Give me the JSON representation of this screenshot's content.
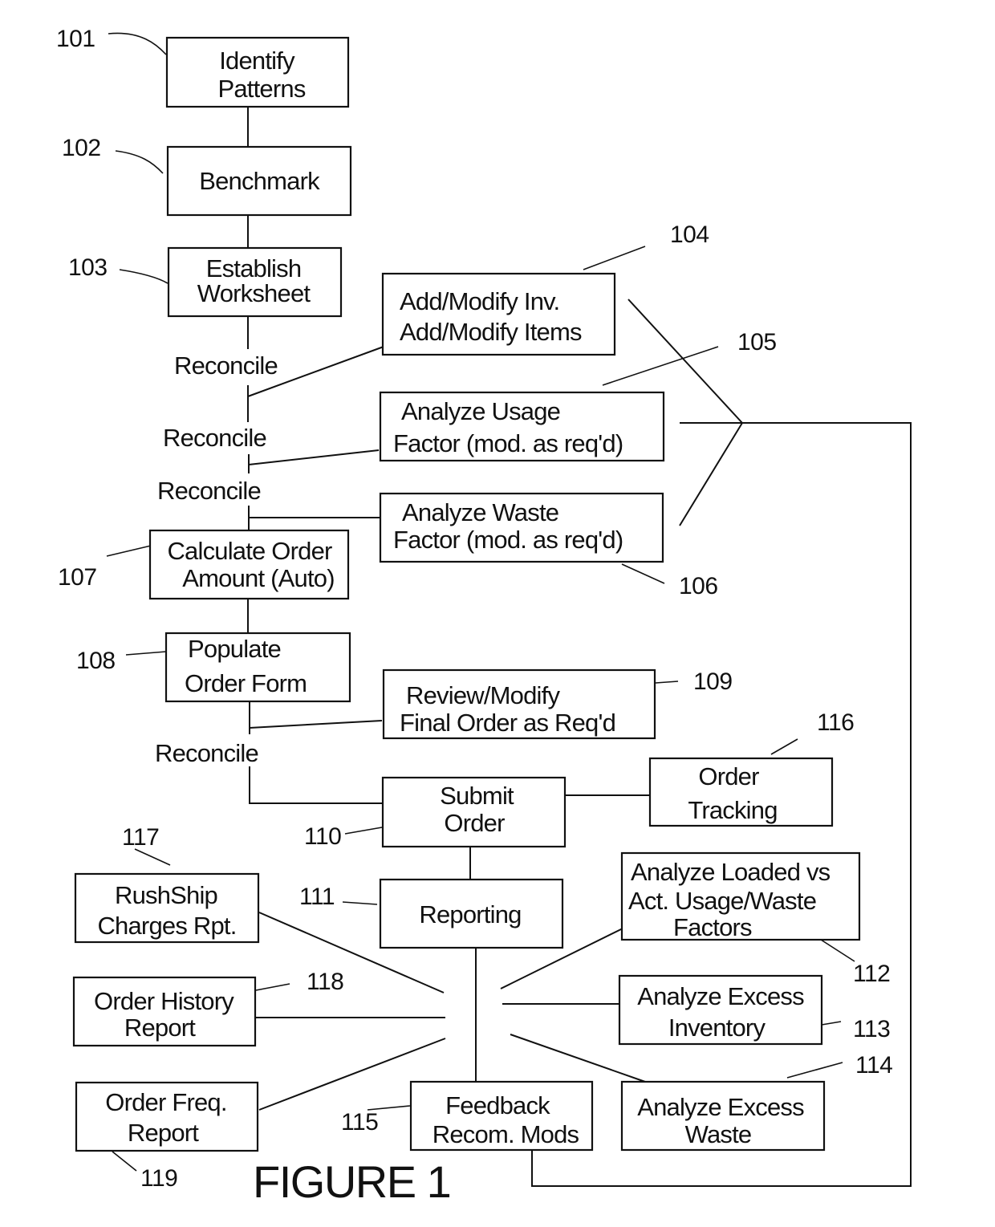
{
  "figure_title": "FIGURE 1",
  "nodes": {
    "n101": {
      "ref": "101",
      "lines": [
        "Identify",
        "Patterns"
      ]
    },
    "n102": {
      "ref": "102",
      "lines": [
        "Benchmark"
      ]
    },
    "n103": {
      "ref": "103",
      "lines": [
        "Establish",
        "Worksheet"
      ]
    },
    "n104": {
      "ref": "104",
      "lines": [
        "Add/Modify Inv.",
        "Add/Modify Items"
      ]
    },
    "n105": {
      "ref": "105",
      "lines": [
        "Analyze Usage",
        "Factor (mod. as req'd)"
      ]
    },
    "n106": {
      "ref": "106",
      "lines": [
        "Analyze Waste",
        "Factor (mod. as req'd)"
      ]
    },
    "n107": {
      "ref": "107",
      "lines": [
        "Calculate Order",
        "Amount (Auto)"
      ]
    },
    "n108": {
      "ref": "108",
      "lines": [
        "Populate",
        "Order Form"
      ]
    },
    "n109": {
      "ref": "109",
      "lines": [
        "Review/Modify",
        "Final Order as Req'd"
      ]
    },
    "n110": {
      "ref": "110",
      "lines": [
        "Submit",
        "Order"
      ]
    },
    "n111": {
      "ref": "111",
      "lines": [
        "Reporting"
      ]
    },
    "n112": {
      "ref": "112",
      "lines": [
        "Analyze Loaded vs",
        "Act. Usage/Waste",
        "Factors"
      ]
    },
    "n113": {
      "ref": "113",
      "lines": [
        "Analyze Excess",
        "Inventory"
      ]
    },
    "n114": {
      "ref": "114",
      "lines": [
        "Analyze Excess",
        "Waste"
      ]
    },
    "n115": {
      "ref": "115",
      "lines": [
        "Feedback",
        "Recom. Mods"
      ]
    },
    "n116": {
      "ref": "116",
      "lines": [
        "Order",
        "Tracking"
      ]
    },
    "n117": {
      "ref": "117",
      "lines": [
        "RushShip",
        "Charges Rpt."
      ]
    },
    "n118": {
      "ref": "118",
      "lines": [
        "Order History",
        "Report"
      ]
    },
    "n119": {
      "ref": "119",
      "lines": [
        "Order Freq.",
        "Report"
      ]
    }
  },
  "edge_labels": {
    "reconcile_1": "Reconcile",
    "reconcile_2": "Reconcile",
    "reconcile_3": "Reconcile",
    "reconcile_4": "Reconcile"
  }
}
